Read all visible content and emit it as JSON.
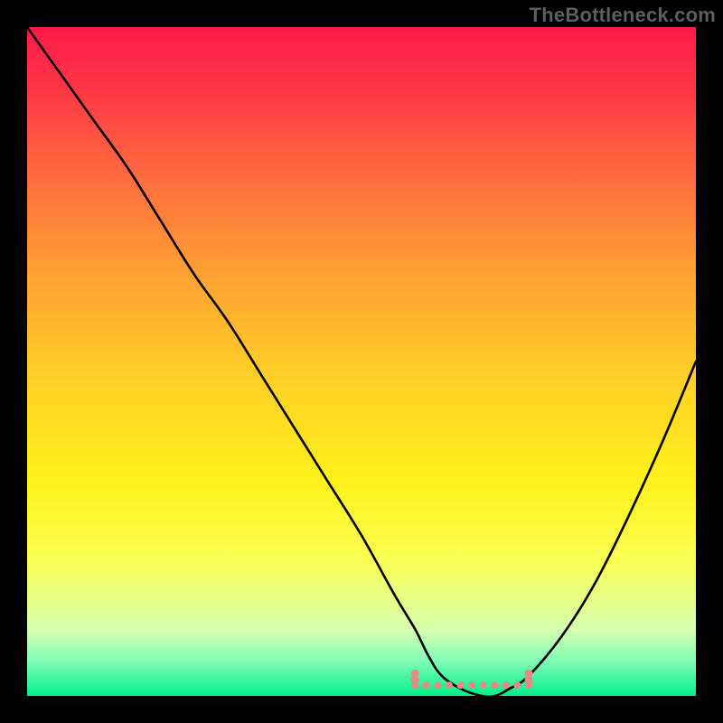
{
  "watermark": "TheBottleneck.com",
  "chart_data": {
    "type": "line",
    "title": "",
    "xlabel": "",
    "ylabel": "",
    "xlim": [
      0,
      100
    ],
    "ylim": [
      0,
      100
    ],
    "background": "rainbow-vertical-red-to-green",
    "series": [
      {
        "name": "bottleneck-curve",
        "x": [
          0,
          5,
          10,
          15,
          20,
          25,
          30,
          35,
          40,
          45,
          50,
          55,
          58,
          60,
          62,
          65,
          68,
          70,
          72,
          75,
          80,
          85,
          90,
          95,
          100
        ],
        "y": [
          100,
          93,
          86,
          79,
          71,
          63,
          56,
          48,
          40,
          32,
          24,
          15,
          10,
          6,
          3,
          1,
          0,
          0,
          1,
          3,
          9,
          17,
          27,
          38,
          50
        ]
      }
    ],
    "annotations": [
      {
        "name": "optimal-range-dots",
        "shape": "dot-band",
        "x_range": [
          58,
          75
        ],
        "y": 2,
        "color": "#e98986"
      }
    ]
  }
}
